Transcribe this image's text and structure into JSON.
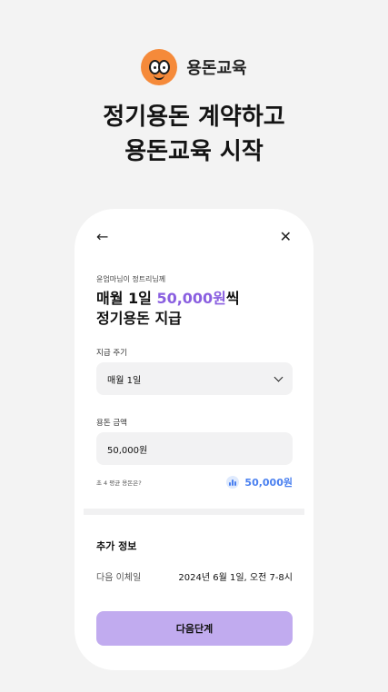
{
  "brand": {
    "name": "용돈교육",
    "logo_icon": "smiley-face-icon",
    "logo_color": "#f58a3a"
  },
  "headline": {
    "line1": "정기용돈 계약하고",
    "line2": "용돈교육 시작"
  },
  "nav": {
    "back_icon": "←",
    "close_icon": "✕"
  },
  "form": {
    "subtitle": "윤엄마님이 정트리님께",
    "title_prefix": "매월 1일 ",
    "title_amount": "50,000원",
    "title_suffix": "씩",
    "title_line2": "정기용돈 지급",
    "cycle_label": "지급 주기",
    "cycle_value": "매월 1일",
    "amount_label": "용돈 금액",
    "amount_value": "50,000원",
    "hint": "초 4 평균 용돈은?",
    "avg_amount": "50,000원",
    "accent_color": "#8a5fe0"
  },
  "extra": {
    "title": "추가 정보",
    "next_transfer_label": "다음 이체일",
    "next_transfer_value": "2024년 6월 1일, 오전 7-8시"
  },
  "cta": {
    "label": "다음단계",
    "color": "#c1abef"
  }
}
